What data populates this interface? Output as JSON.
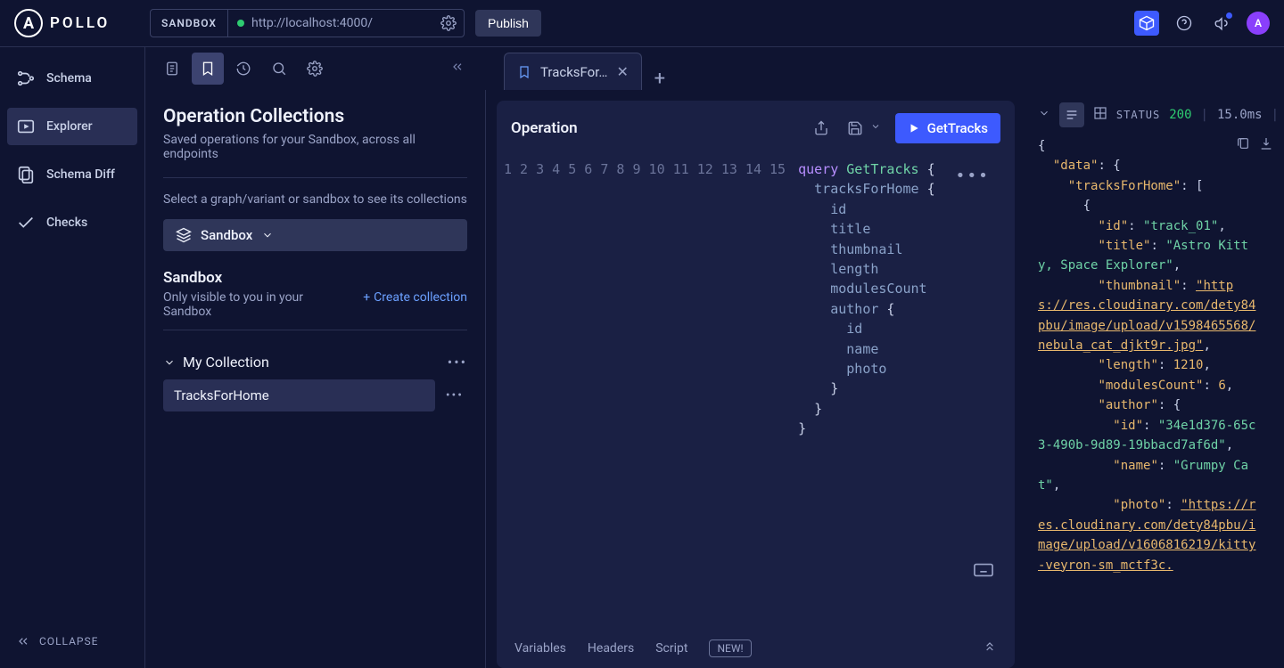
{
  "top": {
    "logo_text": "POLLO",
    "sandbox_badge": "SANDBOX",
    "url": "http://localhost:4000/",
    "publish": "Publish"
  },
  "sidebar": {
    "items": [
      {
        "label": "Schema"
      },
      {
        "label": "Explorer"
      },
      {
        "label": "Schema Diff"
      },
      {
        "label": "Checks"
      }
    ],
    "collapse": "COLLAPSE"
  },
  "tabs": {
    "active_label": "TracksFor…"
  },
  "collections_panel": {
    "title": "Operation Collections",
    "subtitle": "Saved operations for your Sandbox, across all endpoints",
    "select_prompt": "Select a graph/variant or sandbox to see its collections",
    "sandbox_button": "Sandbox",
    "sandbox_heading": "Sandbox",
    "sandbox_sub": "Only visible to you in your Sandbox",
    "create_collection": "Create collection",
    "collection_name": "My Collection",
    "operation_item": "TracksForHome"
  },
  "operation": {
    "panel_title": "Operation",
    "run_label": "GetTracks",
    "footer": {
      "variables": "Variables",
      "headers": "Headers",
      "script": "Script",
      "badge": "NEW!"
    }
  },
  "editor": {
    "lines": 15,
    "tokens": {
      "l1_kw": "query",
      "l1_name": "GetTracks",
      "l2_field": "tracksForHome",
      "l3": "id",
      "l4": "title",
      "l5": "thumbnail",
      "l6": "length",
      "l7": "modulesCount",
      "l8": "author",
      "l9": "id",
      "l10": "name",
      "l11": "photo"
    }
  },
  "response": {
    "status_label": "STATUS",
    "status_code": "200",
    "time": "15.0ms",
    "json": {
      "id": "track_01",
      "title": "Astro Kitty, Space Explorer",
      "thumbnail": "https://res.cloudinary.com/dety84pbu/image/upload/v1598465568/nebula_cat_djkt9r.jpg",
      "length": "1210",
      "modulesCount": "6",
      "author_id": "34e1d376-65c3-490b-9d89-19bbacd7af6d",
      "author_name": "Grumpy Cat",
      "author_photo": "https://res.cloudinary.com/dety84pbu/image/upload/v1606816219/kitty-veyron-sm_mctf3c."
    }
  }
}
